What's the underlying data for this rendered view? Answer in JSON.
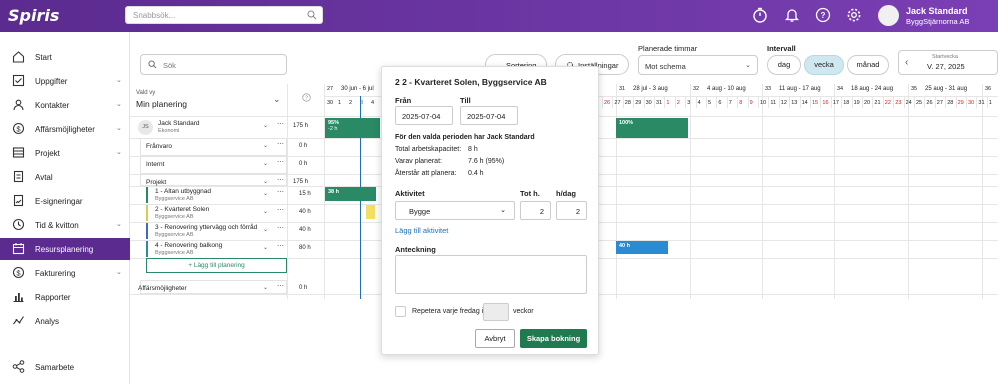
{
  "app": {
    "logo": "Spiris",
    "search_placeholder": "Snabbsök..."
  },
  "user": {
    "name": "Jack Standard",
    "company": "ByggStjärnorna AB"
  },
  "nav": [
    {
      "label": "Start",
      "icon": "home-icon",
      "chevron": false
    },
    {
      "label": "Uppgifter",
      "icon": "checklist-icon",
      "chevron": true
    },
    {
      "label": "Kontakter",
      "icon": "contacts-icon",
      "chevron": true
    },
    {
      "label": "Affärsmöjligheter",
      "icon": "money-icon",
      "chevron": true
    },
    {
      "label": "Projekt",
      "icon": "table-icon",
      "chevron": true
    },
    {
      "label": "Avtal",
      "icon": "contract-icon",
      "chevron": false
    },
    {
      "label": "E-signeringar",
      "icon": "sign-icon",
      "chevron": false
    },
    {
      "label": "Tid & kvitton",
      "icon": "clock-icon",
      "chevron": true
    },
    {
      "label": "Resursplanering",
      "icon": "calendar-icon",
      "chevron": false
    },
    {
      "label": "Fakturering",
      "icon": "invoice-icon",
      "chevron": true
    },
    {
      "label": "Rapporter",
      "icon": "chart-icon",
      "chevron": false
    },
    {
      "label": "Analys",
      "icon": "analysis-icon",
      "chevron": false
    }
  ],
  "share": {
    "label": "Samarbete"
  },
  "toolbar": {
    "search_placeholder": "Sök",
    "sort": "Sortering",
    "settings": "Inställningar",
    "planned_label": "Planerade timmar",
    "planned_value": "Mot schema",
    "interval_label": "Intervall",
    "day": "dag",
    "week": "vecka",
    "month": "månad",
    "start_label": "Startvecka",
    "start_value": "V. 27, 2025"
  },
  "view": {
    "label": "Vald vy",
    "value": "Min planering"
  },
  "weeks": [
    {
      "num": "27",
      "range": "30 jun - 6 jul"
    },
    {
      "num": "31",
      "range": "28 jul - 3 aug"
    },
    {
      "num": "32",
      "range": "4 aug - 10 aug"
    },
    {
      "num": "33",
      "range": "11 aug - 17 aug"
    },
    {
      "num": "34",
      "range": "18 aug - 24 aug"
    },
    {
      "num": "35",
      "range": "25 aug - 31 aug"
    },
    {
      "num": "36",
      "range": ""
    }
  ],
  "days_left": [
    "30",
    "1",
    "2",
    "3",
    "4"
  ],
  "days_right": [
    "26",
    "27",
    "28",
    "29",
    "30",
    "31",
    "1",
    "2",
    "3",
    "4",
    "5",
    "6",
    "7",
    "8",
    "9",
    "10",
    "11",
    "12",
    "13",
    "14",
    "15",
    "16",
    "17",
    "18",
    "19",
    "20",
    "21",
    "22",
    "23",
    "24",
    "25",
    "26",
    "27",
    "28",
    "29",
    "30",
    "31",
    "1"
  ],
  "rows": [
    {
      "title": "Jack Standard",
      "sub": "Ekonomi",
      "hours": "175 h",
      "avatar": "JS"
    },
    {
      "title": "Frånvaro",
      "hours": "0 h"
    },
    {
      "title": "Internt",
      "hours": "0 h"
    },
    {
      "title": "Projekt",
      "hours": "175 h"
    },
    {
      "title": "1 - Altan utbyggnad",
      "sub": "Byggservice AB",
      "hours": "15 h"
    },
    {
      "title": "2 - Kvarteret Solen",
      "sub": "Byggservice AB",
      "hours": "40 h"
    },
    {
      "title": "3 - Renovering yttervägg och förråd",
      "sub": "Byggservice AB",
      "hours": "40 h"
    },
    {
      "title": "4 - Renovering balkong",
      "sub": "Byggservice AB",
      "hours": "80 h"
    },
    {
      "title": "Affärsmöjligheter",
      "hours": "0 h"
    }
  ],
  "add_planning": "Lägg till planering",
  "bars": {
    "b1": "95%",
    "b1s": "-2 h",
    "b2": "100%",
    "b3": "38 h",
    "b4": "40 h"
  },
  "popup": {
    "title": "2 2 - Kvarteret Solen, Byggservice AB",
    "from_label": "Från",
    "from_value": "2025-07-04",
    "to_label": "Till",
    "to_value": "2025-07-04",
    "period_title": "För den valda perioden har Jack Standard",
    "cap_label": "Total arbetskapacitet:",
    "cap_value": "8 h",
    "planned_label": "Varav planerat:",
    "planned_value": "7.6 h (95%)",
    "left_label": "Återstår att planera:",
    "left_value": "0.4 h",
    "activity_label": "Aktivitet",
    "activity_value": "Bygge",
    "tot_label": "Tot h.",
    "tot_value": "2",
    "hday_label": "h/dag",
    "hday_value": "2",
    "add_activity": "Lägg till aktivitet",
    "note_label": "Anteckning",
    "repeat_label": "Repetera varje fredag i",
    "weeks_label": "veckor",
    "cancel": "Avbryt",
    "submit": "Skapa bokning"
  }
}
